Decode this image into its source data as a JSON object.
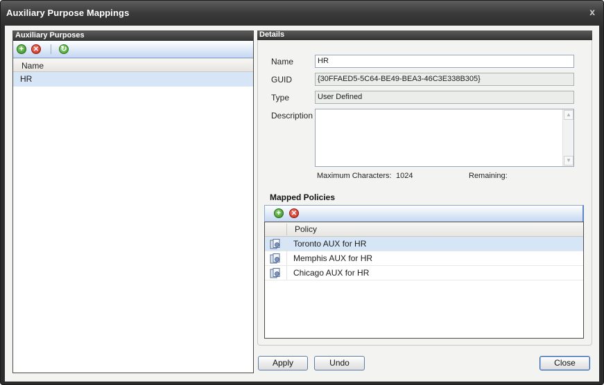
{
  "window": {
    "title": "Auxiliary Purpose Mappings",
    "close_glyph": "x"
  },
  "left_panel": {
    "header": "Auxiliary Purposes",
    "toolbar": {
      "add_icon": "add-icon",
      "delete_icon": "delete-icon",
      "refresh_icon": "refresh-icon"
    },
    "column_header": "Name",
    "rows": [
      "HR"
    ]
  },
  "details": {
    "header": "Details",
    "name_label": "Name",
    "name_value": "HR",
    "guid_label": "GUID",
    "guid_value": "{30FFAED5-5C64-BE49-BEA3-46C3E338B305}",
    "type_label": "Type",
    "type_value": "User Defined",
    "description_label": "Description",
    "description_value": "",
    "max_chars_label": "Maximum Characters:",
    "max_chars_value": "1024",
    "remaining_label": "Remaining:",
    "remaining_value": ""
  },
  "mapped_policies": {
    "title": "Mapped Policies",
    "column_header": "Policy",
    "rows": [
      "Toronto AUX for HR",
      "Memphis AUX for HR",
      "Chicago AUX for HR"
    ]
  },
  "buttons": {
    "apply": "Apply",
    "undo": "Undo",
    "close": "Close"
  },
  "colors": {
    "selection": "#d7e6f7",
    "header_dark": "#333333",
    "toolbar_blue": "#c6d8f3"
  }
}
